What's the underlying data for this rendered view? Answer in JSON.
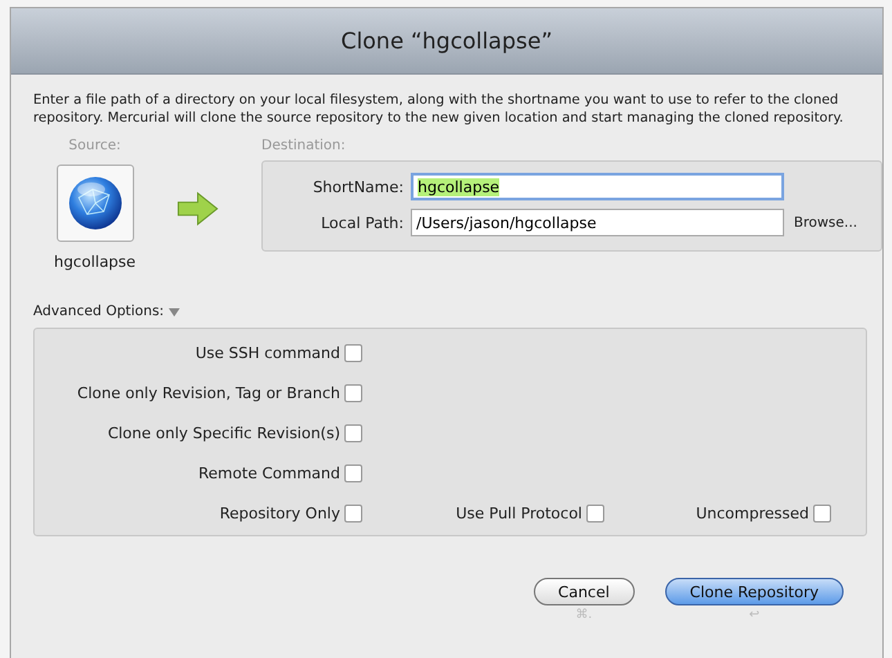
{
  "window": {
    "title": "Clone “hgcollapse”"
  },
  "description": "Enter a file path of a directory on your local filesystem, along with the shortname you want to use to refer to the cloned repository. Mercurial will clone the source repository to the new given location and start managing the cloned repository.",
  "source": {
    "label": "Source:",
    "name": "hgcollapse"
  },
  "destination": {
    "label": "Destination:",
    "fields": [
      {
        "label": "ShortName:",
        "value": "hgcollapse",
        "focused": true,
        "selected": true
      },
      {
        "label": "Local Path:",
        "value": "/Users/jason/hgcollapse",
        "focused": false,
        "selected": false,
        "action": "Browse..."
      }
    ]
  },
  "advanced": {
    "label": "Advanced Options:",
    "expanded": true,
    "rows": [
      [
        {
          "label": "Use SSH command",
          "checked": false
        }
      ],
      [
        {
          "label": "Clone only Revision, Tag or Branch",
          "checked": false
        }
      ],
      [
        {
          "label": "Clone only Specific Revision(s)",
          "checked": false
        }
      ],
      [
        {
          "label": "Remote Command",
          "checked": false
        }
      ],
      [
        {
          "label": "Repository Only",
          "checked": false
        },
        {
          "label": "Use Pull Protocol",
          "checked": false
        },
        {
          "label": "Uncompressed",
          "checked": false
        }
      ]
    ]
  },
  "buttons": [
    {
      "label": "Cancel",
      "default": false,
      "shortcut": "⌘."
    },
    {
      "label": "Clone Repository",
      "default": true,
      "shortcut": "↩"
    }
  ]
}
